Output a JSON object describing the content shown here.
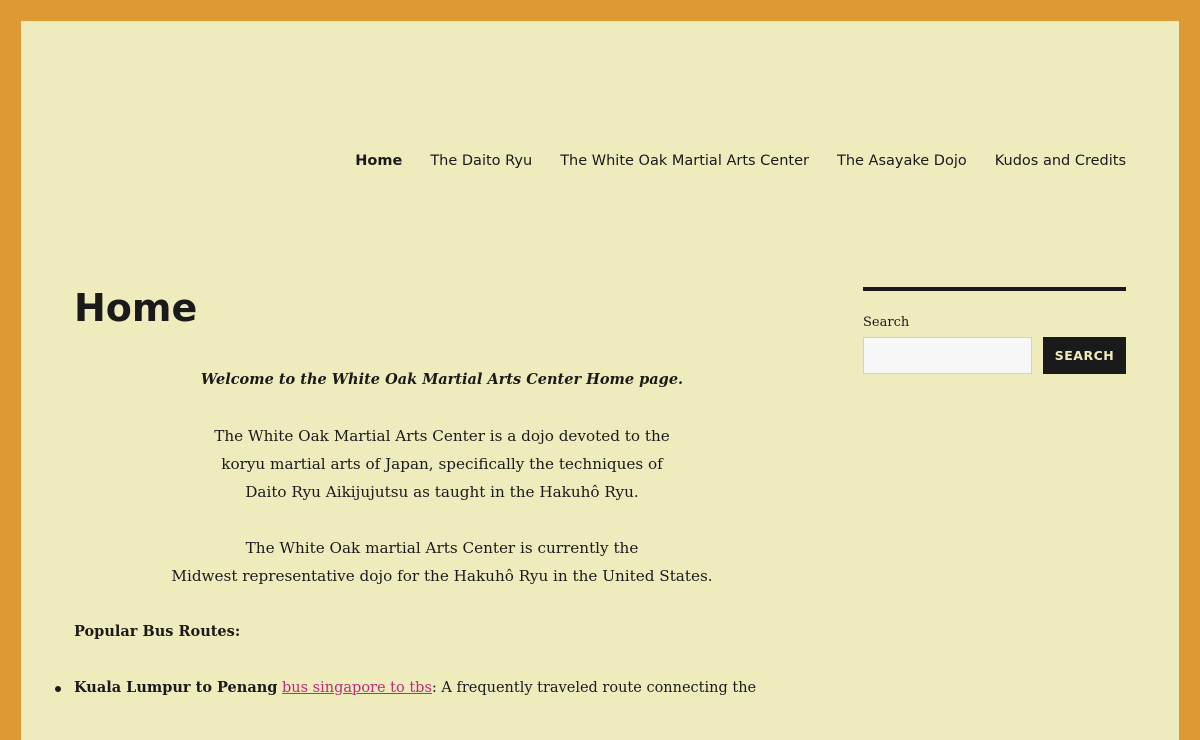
{
  "nav": {
    "items": [
      {
        "label": "Home",
        "current": true
      },
      {
        "label": "The Daito Ryu"
      },
      {
        "label": "The White Oak Martial Arts Center"
      },
      {
        "label": "The Asayake Dojo"
      },
      {
        "label": "Kudos and Credits"
      }
    ]
  },
  "page": {
    "title": "Home"
  },
  "content": {
    "welcome": "Welcome to the White Oak Martial Arts Center Home page.",
    "intro_lines": [
      "The White Oak Martial Arts Center is a dojo devoted to the",
      "koryu martial arts of Japan, specifically the techniques of",
      "Daito Ryu Aikijujutsu as taught in the Hakuhô Ryu."
    ],
    "rep_lines": [
      "The White Oak martial Arts Center is currently the",
      "Midwest representative dojo for the Hakuhô Ryu in the United States."
    ],
    "routes_heading": "Popular Bus Routes:",
    "routes": [
      {
        "title": "Kuala Lumpur to Penang",
        "link_text": "bus singapore to tbs",
        "description": ": A frequently traveled route connecting the"
      }
    ]
  },
  "sidebar": {
    "search_label": "Search",
    "search_value": "",
    "search_button": "SEARCH"
  },
  "colors": {
    "frame": "#dd9933",
    "background": "#eeebbd",
    "text": "#1a1a1a",
    "link": "#bf2a7b"
  }
}
